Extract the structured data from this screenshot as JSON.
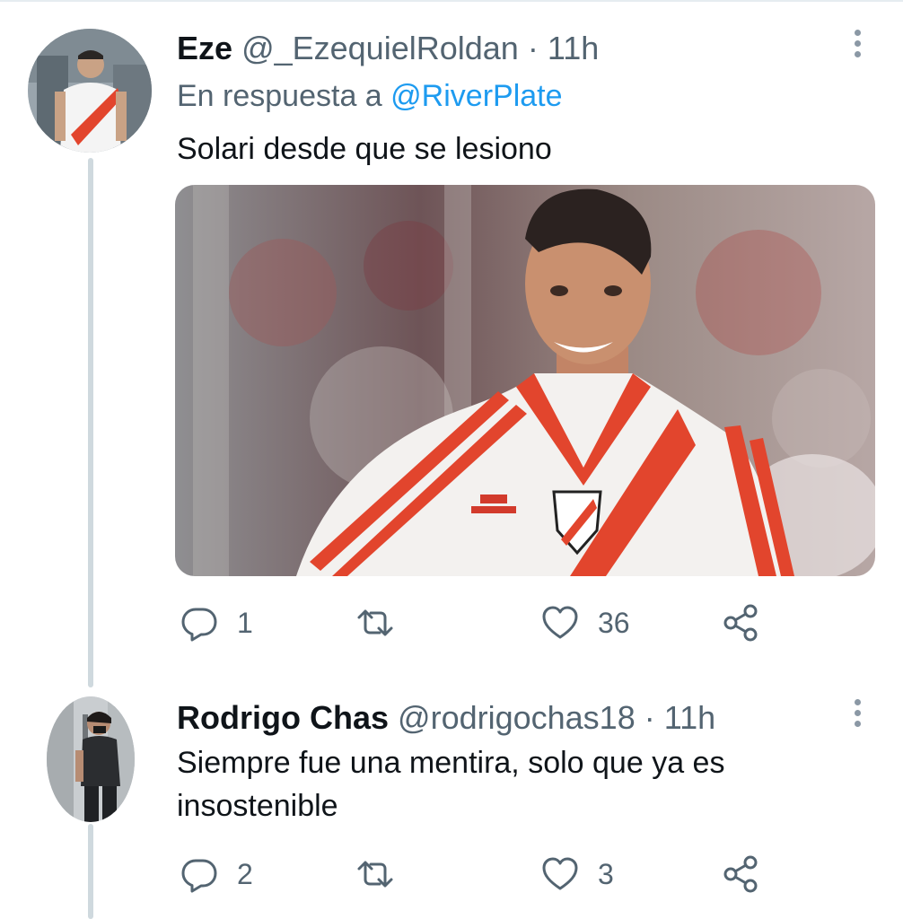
{
  "tweets": [
    {
      "name": "Eze",
      "handle": "@_EzequielRoldan",
      "separator": "·",
      "time": "11h",
      "replying_prefix": "En respuesta a",
      "replying_to": "@RiverPlate",
      "text": "Solari desde que se lesiono",
      "media_kit_brand": "adidas",
      "actions": {
        "replies": "1",
        "retweets": "",
        "likes": "36"
      }
    },
    {
      "name": "Rodrigo Chas",
      "handle": "@rodrigochas18",
      "separator": "·",
      "time": "11h",
      "text_line1": "Siempre fue una mentira, solo que ya es",
      "text_line2": "insostenible",
      "actions": {
        "replies": "2",
        "retweets": "",
        "likes": "3"
      }
    }
  ],
  "colors": {
    "accent": "#1d9bf0",
    "muted": "#536471",
    "thread": "#cfd9de",
    "river_red": "#e2452d"
  },
  "icons": [
    "reply-icon",
    "retweet-icon",
    "like-icon",
    "share-icon",
    "more-options-icon"
  ]
}
